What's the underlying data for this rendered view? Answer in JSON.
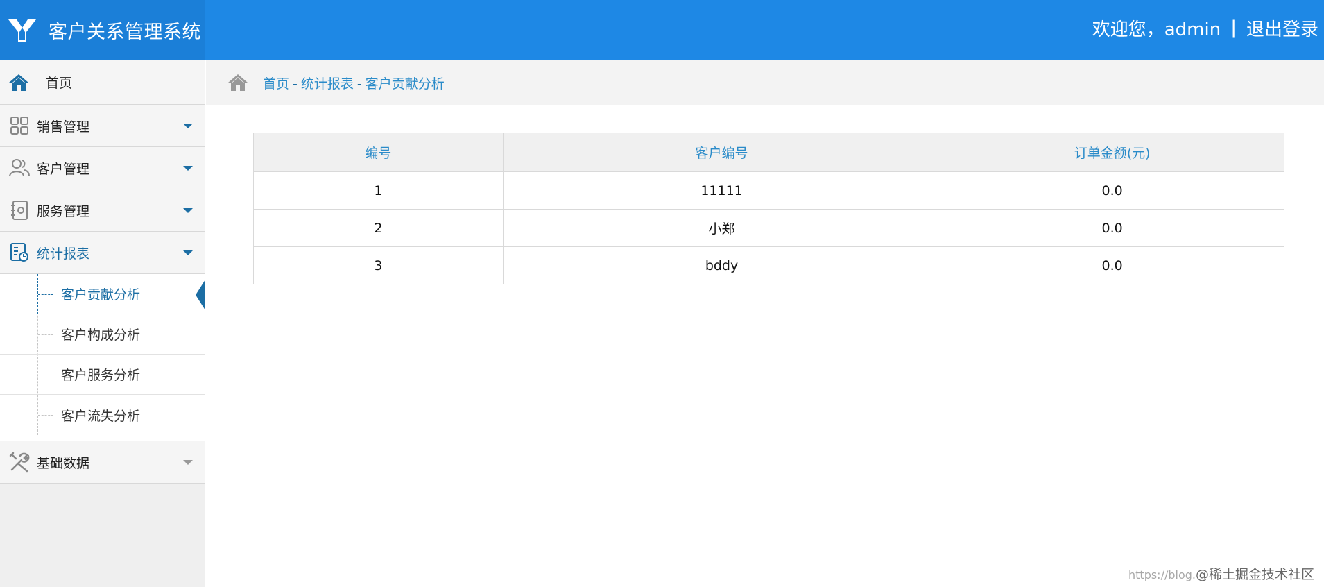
{
  "header": {
    "title": "客户关系管理系统",
    "welcome": "欢迎您，admin",
    "separator": "|",
    "logout": "退出登录"
  },
  "sidebar": {
    "home": "首页",
    "items": [
      {
        "label": "销售管理"
      },
      {
        "label": "客户管理"
      },
      {
        "label": "服务管理"
      },
      {
        "label": "统计报表"
      },
      {
        "label": "基础数据"
      }
    ],
    "report_sub": [
      {
        "label": "客户贡献分析"
      },
      {
        "label": "客户构成分析"
      },
      {
        "label": "客户服务分析"
      },
      {
        "label": "客户流失分析"
      }
    ]
  },
  "breadcrumb": {
    "home": "首页",
    "sep": "-",
    "section": "统计报表",
    "current": "客户贡献分析"
  },
  "table": {
    "headers": [
      "编号",
      "客户编号",
      "订单金额(元)"
    ],
    "rows": [
      [
        "1",
        "11111",
        "0.0"
      ],
      [
        "2",
        "小郑",
        "0.0"
      ],
      [
        "3",
        "bddy",
        "0.0"
      ]
    ]
  },
  "watermark": {
    "prefix": "https://blog.",
    "brand": "@稀土掘金技术社区"
  },
  "colors": {
    "header_bg": "#1e88e5",
    "accent": "#1c6ea4",
    "link": "#2a8bc9"
  }
}
